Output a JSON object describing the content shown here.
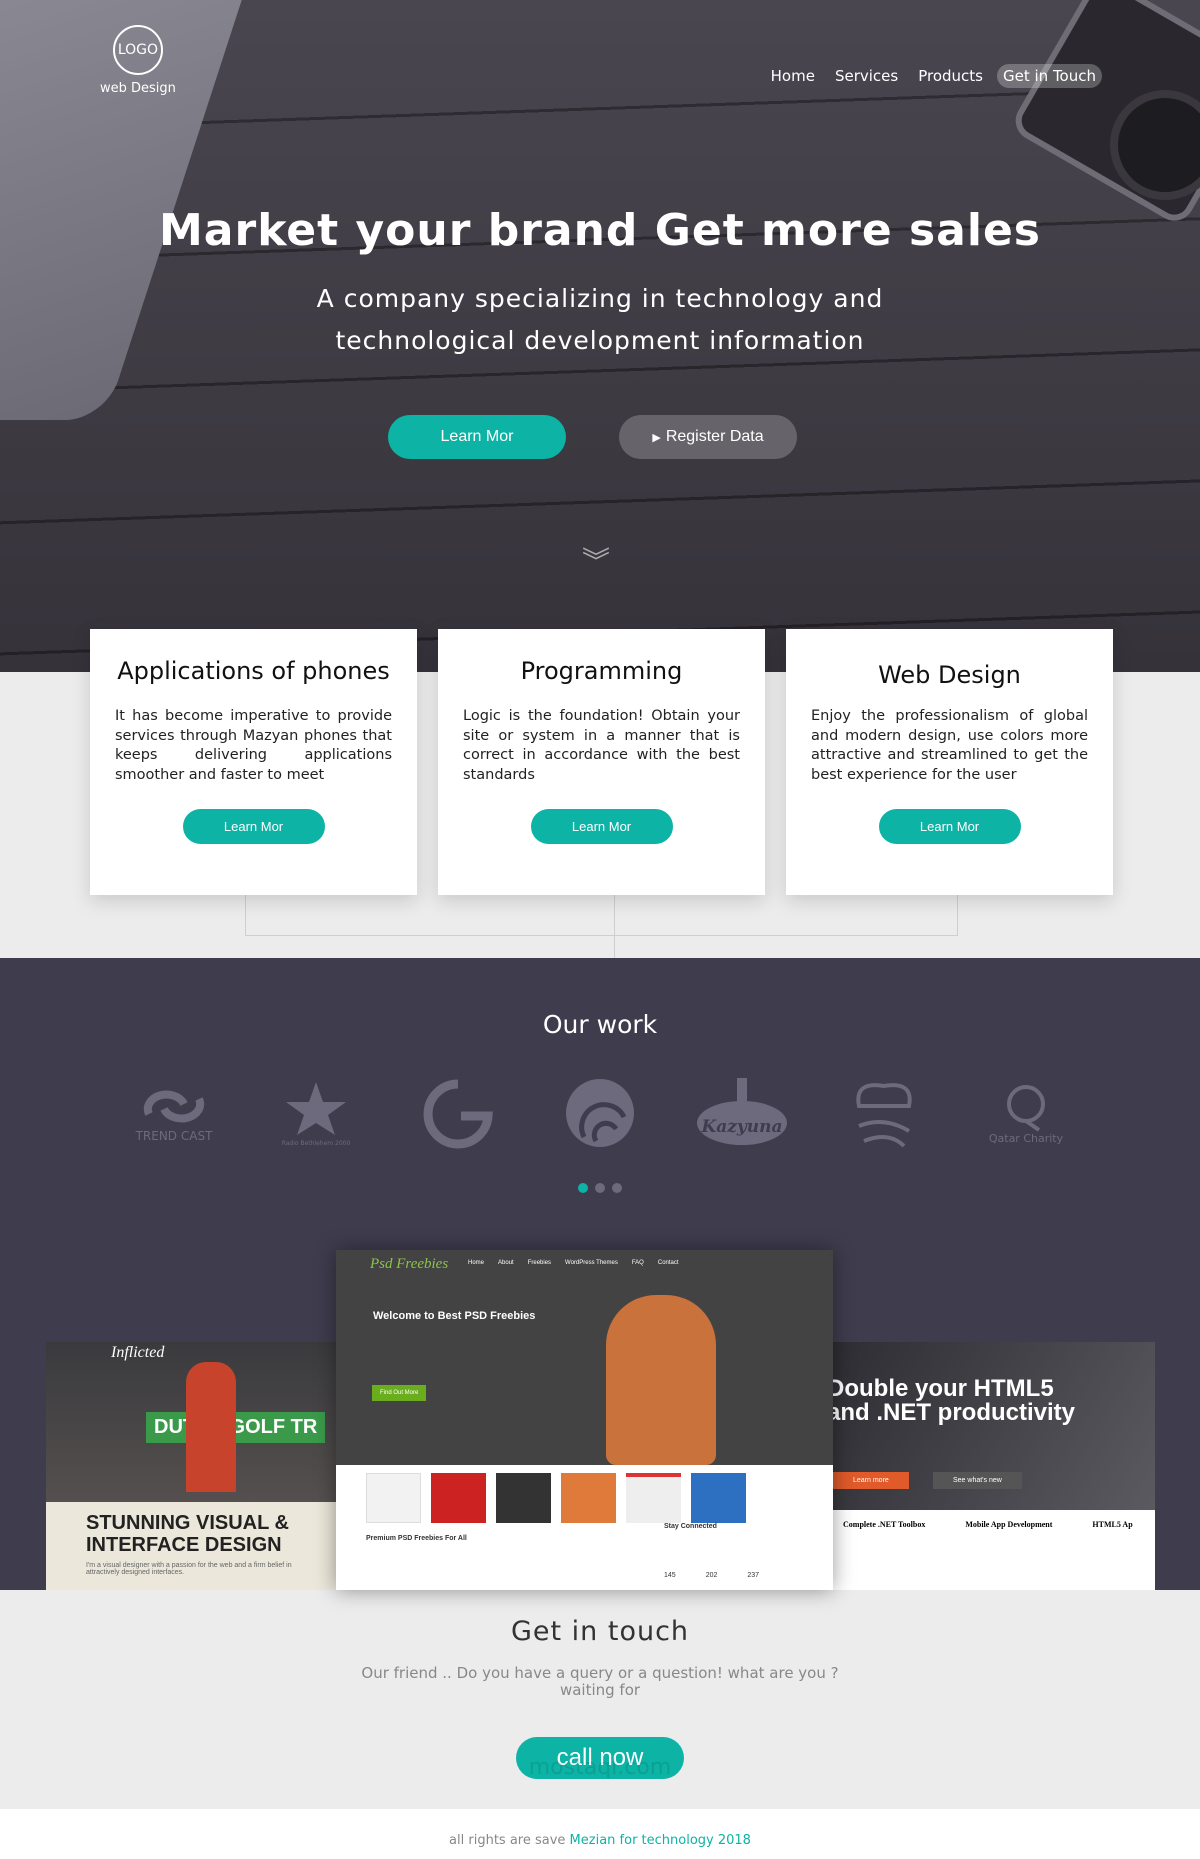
{
  "brand": {
    "logo_text": "LOGO",
    "subtitle": "web Design"
  },
  "nav": [
    {
      "label": "Home"
    },
    {
      "label": "Services"
    },
    {
      "label": "Products"
    },
    {
      "label": "Get in Touch",
      "active": true
    }
  ],
  "hero": {
    "title": "Market your brand Get more sales",
    "subtitle_line1": "A company specializing in technology and",
    "subtitle_line2": "technological development information",
    "primary_button": "Learn Mor",
    "secondary_button": "Register Data"
  },
  "cards": [
    {
      "title": "Applications of phones",
      "text": "It has become imperative to provide services through Mazyan phones that keeps delivering applications smoother and faster to meet",
      "button": "Learn Mor"
    },
    {
      "title": "Programming",
      "text": "Logic is the foundation! Obtain your site or system in a manner that is correct in accordance with the best standards",
      "button": "Learn Mor"
    },
    {
      "title": "Web Design",
      "text": "Enjoy the professionalism of global and modern design, use colors more attractive and streamlined to get the best experience for the user",
      "button": "Learn Mor"
    }
  ],
  "work": {
    "title": "Our work",
    "clients": [
      "TREND CAST",
      "Radio Bethlehem 2000",
      "G",
      "Globe",
      "Kazyuna",
      "Chef",
      "Qatar Charity"
    ],
    "carousel_active": 0,
    "carousel_count": 3,
    "shots": {
      "left": {
        "brand": "Inflicted",
        "banner": "DUTCH GOLF TR",
        "headline": "STUNNING VISUAL & INTERFACE DESIGN",
        "body": "I'm a visual designer with a passion for the web and a firm belief in attractively designed interfaces."
      },
      "center": {
        "brand": "Psd Freebies",
        "menu": [
          "Home",
          "About",
          "Freebies",
          "WordPress Themes",
          "FAQ",
          "Contact"
        ],
        "welcome": "Welcome to Best PSD Freebies",
        "cta": "Find Out More",
        "section1": "Premium PSD Freebies For All",
        "section2": "Stay Connected",
        "counts": [
          "145",
          "202",
          "237"
        ]
      },
      "right": {
        "headline1": "Double your HTML5",
        "headline2": "and .NET productivity",
        "btn1": "Learn more",
        "btn2": "See what's new",
        "cols": [
          "Complete .NET Toolbox",
          "Mobile App Development",
          "HTML5 Ap"
        ]
      }
    }
  },
  "contact": {
    "title": "Get in touch",
    "text": "Our friend .. Do you have a query or a question! what are you ?waiting for",
    "button": "call now"
  },
  "watermark": "mostaql.com",
  "footer": {
    "text": "all rights are save",
    "company": "Mezian for technology 2018"
  },
  "colors": {
    "accent": "#0db3a5",
    "dark": "#3f3c4e"
  }
}
